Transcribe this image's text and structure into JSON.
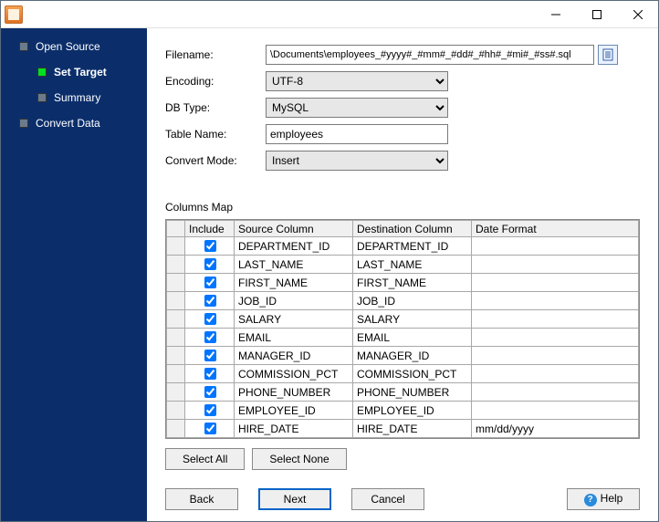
{
  "sidebar": {
    "items": [
      {
        "label": "Open Source"
      },
      {
        "label": "Set Target"
      },
      {
        "label": "Summary"
      },
      {
        "label": "Convert Data"
      }
    ]
  },
  "form": {
    "filename_label": "Filename:",
    "filename_value": "\\Documents\\employees_#yyyy#_#mm#_#dd#_#hh#_#mi#_#ss#.sql",
    "encoding_label": "Encoding:",
    "encoding_value": "UTF-8",
    "dbtype_label": "DB Type:",
    "dbtype_value": "MySQL",
    "tablename_label": "Table Name:",
    "tablename_value": "employees",
    "convertmode_label": "Convert Mode:",
    "convertmode_value": "Insert"
  },
  "columns_map": {
    "title": "Columns Map",
    "headers": {
      "include": "Include",
      "source": "Source Column",
      "destination": "Destination Column",
      "dateformat": "Date Format"
    },
    "rows": [
      {
        "include": true,
        "source": "DEPARTMENT_ID",
        "destination": "DEPARTMENT_ID",
        "dateformat": ""
      },
      {
        "include": true,
        "source": "LAST_NAME",
        "destination": "LAST_NAME",
        "dateformat": ""
      },
      {
        "include": true,
        "source": "FIRST_NAME",
        "destination": "FIRST_NAME",
        "dateformat": ""
      },
      {
        "include": true,
        "source": "JOB_ID",
        "destination": "JOB_ID",
        "dateformat": ""
      },
      {
        "include": true,
        "source": "SALARY",
        "destination": "SALARY",
        "dateformat": ""
      },
      {
        "include": true,
        "source": "EMAIL",
        "destination": "EMAIL",
        "dateformat": ""
      },
      {
        "include": true,
        "source": "MANAGER_ID",
        "destination": "MANAGER_ID",
        "dateformat": ""
      },
      {
        "include": true,
        "source": "COMMISSION_PCT",
        "destination": "COMMISSION_PCT",
        "dateformat": ""
      },
      {
        "include": true,
        "source": "PHONE_NUMBER",
        "destination": "PHONE_NUMBER",
        "dateformat": ""
      },
      {
        "include": true,
        "source": "EMPLOYEE_ID",
        "destination": "EMPLOYEE_ID",
        "dateformat": ""
      },
      {
        "include": true,
        "source": "HIRE_DATE",
        "destination": "HIRE_DATE",
        "dateformat": "mm/dd/yyyy"
      }
    ]
  },
  "buttons": {
    "select_all": "Select All",
    "select_none": "Select None",
    "back": "Back",
    "next": "Next",
    "cancel": "Cancel",
    "help": "Help"
  }
}
